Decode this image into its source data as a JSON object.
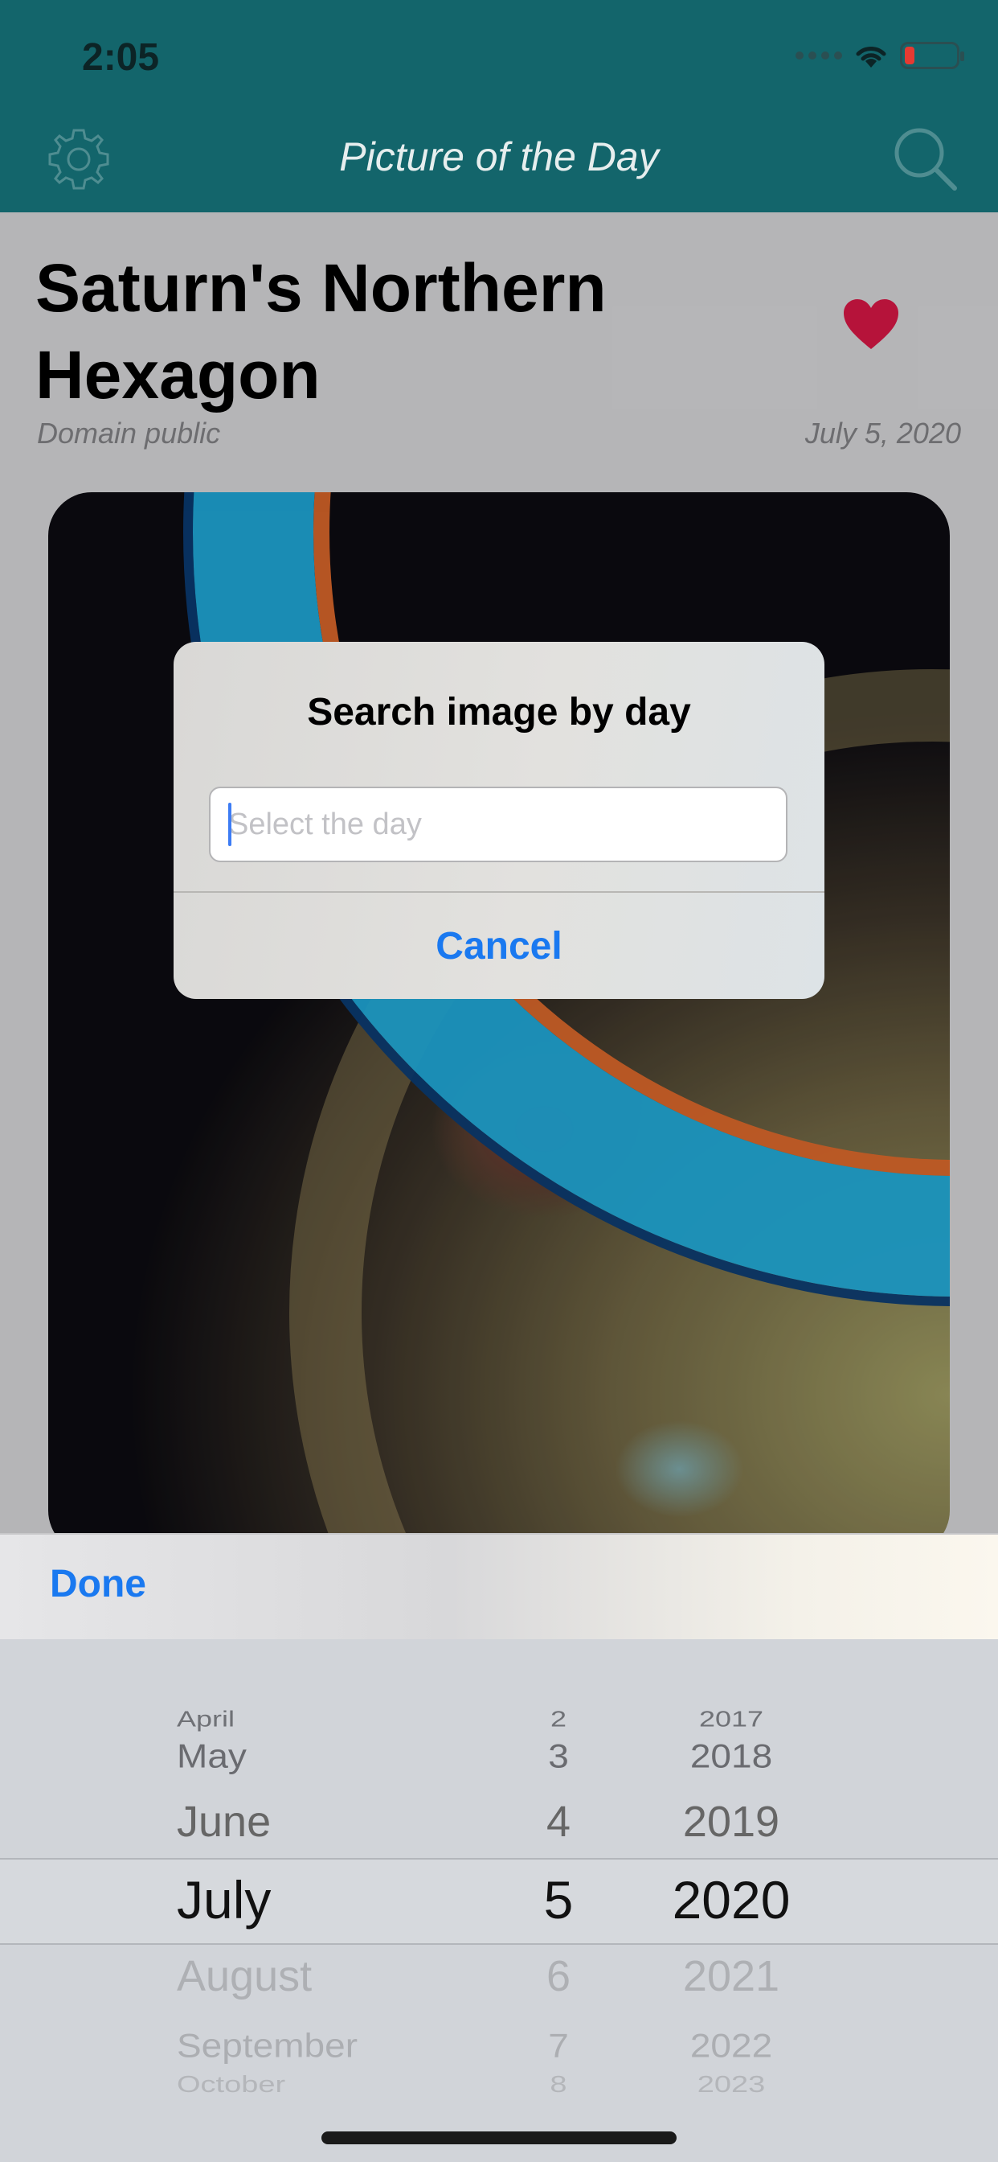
{
  "status_bar": {
    "time": "2:05"
  },
  "nav": {
    "title": "Picture of the Day",
    "left_icon": "gear-icon",
    "right_icon": "search-icon"
  },
  "article": {
    "title": "Saturn's Northern Hexagon",
    "copyright": "Domain public",
    "date": "July 5, 2020",
    "favorite": true,
    "colors": {
      "header": "#13656b",
      "heart": "#d01642",
      "accent": "#1a79f0"
    }
  },
  "alert": {
    "title": "Search image by day",
    "input_placeholder": "Select the day",
    "input_value": "",
    "cancel_label": "Cancel"
  },
  "toolbar": {
    "done_label": "Done"
  },
  "picker": {
    "months": [
      "April",
      "May",
      "June",
      "July",
      "August",
      "September",
      "October"
    ],
    "days": [
      "2",
      "3",
      "4",
      "5",
      "6",
      "7",
      "8"
    ],
    "years": [
      "2017",
      "2018",
      "2019",
      "2020",
      "2021",
      "2022",
      "2023"
    ],
    "selected": {
      "month": "July",
      "day": "5",
      "year": "2020"
    }
  }
}
